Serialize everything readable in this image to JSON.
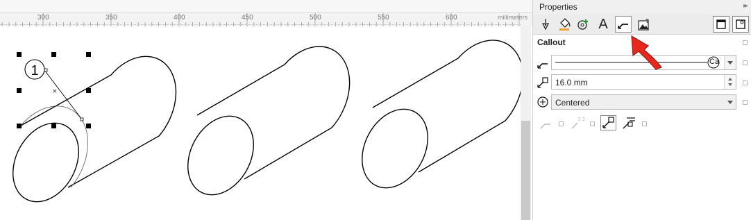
{
  "ruler": {
    "labels": [
      "300",
      "350",
      "400",
      "450",
      "500",
      "550",
      "600"
    ],
    "unit": "millimeters",
    "close_glyph": "✕"
  },
  "drawing": {
    "callout_number": "1"
  },
  "panel": {
    "title": "Properties",
    "collapse_glyph": "▸▸",
    "section_title": "Callout",
    "line_style": {
      "end_marker": "Ca"
    },
    "length": {
      "value": "16.0 mm"
    },
    "position": {
      "value": "Centered"
    },
    "tabs": [
      {
        "name": "outline-pen-tab",
        "icon": "pen-nib-icon"
      },
      {
        "name": "fill-tab",
        "icon": "paint-bucket-icon"
      },
      {
        "name": "effects-tab",
        "icon": "add-effect-icon"
      },
      {
        "name": "text-tab",
        "icon": "letter-a-icon",
        "glyph": "A"
      },
      {
        "name": "callout-tab",
        "icon": "callout-line-icon",
        "active": true
      },
      {
        "name": "image-tab",
        "icon": "image-icon"
      }
    ],
    "highlight_color": "#e8281e"
  }
}
